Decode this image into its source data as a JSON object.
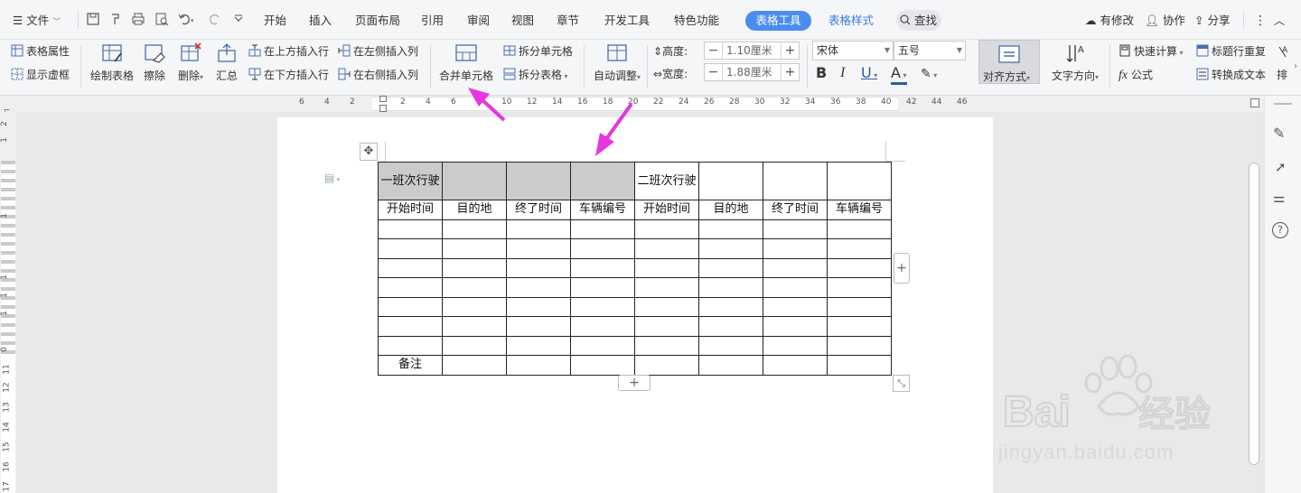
{
  "menubar": {
    "file_label": "文件",
    "tabs": [
      "开始",
      "插入",
      "页面布局",
      "引用",
      "审阅",
      "视图",
      "章节",
      "开发工具",
      "特色功能"
    ],
    "table_tools": "表格工具",
    "table_style": "表格样式",
    "search": "查找",
    "has_changes": "有修改",
    "collaborate": "协作",
    "share": "分享"
  },
  "ribbon": {
    "table_properties": "表格属性",
    "show_gridlines": "显示虚框",
    "draw_table": "绘制表格",
    "erase": "擦除",
    "delete": "删除",
    "summary": "汇总",
    "insert_row_above": "在上方插入行",
    "insert_row_below": "在下方插入行",
    "insert_col_left": "在左侧插入列",
    "insert_col_right": "在右侧插入列",
    "merge_cells": "合并单元格",
    "split_cells": "拆分单元格",
    "split_table": "拆分表格",
    "auto_fit": "自动调整",
    "height_label": "高度:",
    "height_value": "1.10厘米",
    "width_label": "宽度:",
    "width_value": "1.88厘米",
    "font_name": "宋体",
    "font_size": "五号",
    "bold": "B",
    "italic": "I",
    "underline": "U",
    "font_color": "A",
    "alignment": "对齐方式",
    "text_direction": "文字方向",
    "quick_calc": "快速计算",
    "formula": "公式",
    "repeat_header": "标题行重复",
    "convert_to_text": "转换成文本",
    "sort_partial": "排"
  },
  "ruler": {
    "h_numbers": [
      "6",
      "4",
      "2",
      "2",
      "4",
      "6",
      "8",
      "10",
      "12",
      "14",
      "16",
      "18",
      "20",
      "22",
      "24",
      "26",
      "28",
      "30",
      "32",
      "34",
      "36",
      "38",
      "40",
      "42",
      "44",
      "46"
    ],
    "v_numbers": [
      "2",
      "1",
      "1",
      "1",
      "1",
      "1",
      "0",
      "11",
      "12",
      "13",
      "14",
      "15",
      "16",
      "17"
    ]
  },
  "table": {
    "rows": [
      [
        "一班次行驶",
        "",
        "",
        "",
        "二班次行驶",
        "",
        "",
        ""
      ],
      [
        "开始时间",
        "目的地",
        "终了时间",
        "车辆编号",
        "开始时间",
        "目的地",
        "终了时间",
        "车辆编号"
      ],
      [
        "",
        "",
        "",
        "",
        "",
        "",
        "",
        ""
      ],
      [
        "",
        "",
        "",
        "",
        "",
        "",
        "",
        ""
      ],
      [
        "",
        "",
        "",
        "",
        "",
        "",
        "",
        ""
      ],
      [
        "",
        "",
        "",
        "",
        "",
        "",
        "",
        ""
      ],
      [
        "",
        "",
        "",
        "",
        "",
        "",
        "",
        ""
      ],
      [
        "",
        "",
        "",
        "",
        "",
        "",
        "",
        ""
      ],
      [
        "",
        "",
        "",
        "",
        "",
        "",
        "",
        ""
      ],
      [
        "备注",
        "",
        "",
        "",
        "",
        "",
        "",
        ""
      ]
    ],
    "highlighted_cells": "row1 col1-4 selected (gray)"
  },
  "colors": {
    "accent": "#4a8df0",
    "arrow": "#e536e0",
    "selection": "#cbcbcb"
  },
  "watermark": {
    "brand": "Bai",
    "brand_du": "经验",
    "url": "jingyan.baidu.com"
  }
}
